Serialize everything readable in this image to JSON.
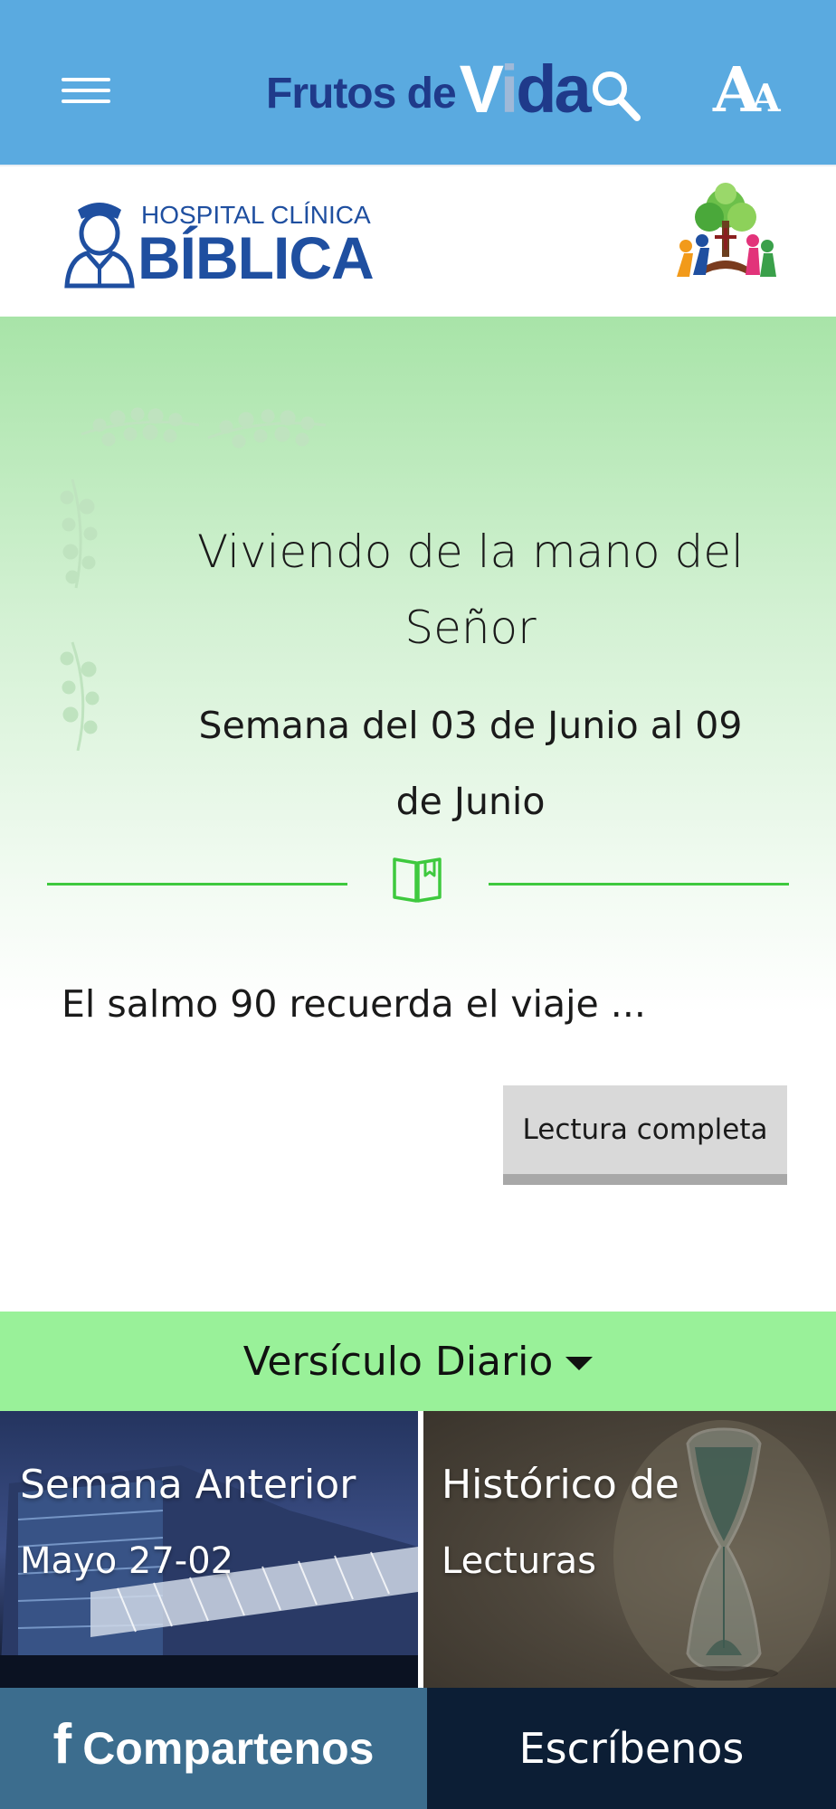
{
  "app": {
    "brand_prefix": "Frutos de",
    "brand_v": "V",
    "brand_i": "i",
    "brand_da": "da"
  },
  "sponsor": {
    "hospital_line1": "HOSPITAL CLÍNICA",
    "hospital_line2": "BÍBLICA"
  },
  "devotional": {
    "title": "Viviendo de la mano del Señor",
    "week": "Semana del 03 de Junio al 09 de Junio",
    "excerpt": "El salmo 90 recuerda el viaje ...",
    "read_button": "Lectura completa"
  },
  "versiculo": {
    "label": "Versículo Diario"
  },
  "tiles": [
    {
      "title": "Semana Anterior",
      "subtitle": "Mayo 27-02"
    },
    {
      "title": "Histórico de",
      "subtitle": "Lecturas"
    }
  ],
  "bottom": {
    "share_icon": "f",
    "share_label": "Compartenos",
    "write_label": "Escríbenos"
  },
  "colors": {
    "appbar": "#5aaae0",
    "brand_blue": "#1f3a8a",
    "accent_green": "#3ec93e",
    "versiculo_bg": "#99f199",
    "share_bg": "#3c6d8e",
    "write_bg": "#0c1e35"
  },
  "icons": {
    "menu": "hamburger-icon",
    "search": "search-icon",
    "font_size": "font-size-icon",
    "book": "book-icon",
    "caret": "caret-down-icon",
    "facebook": "facebook-icon"
  }
}
